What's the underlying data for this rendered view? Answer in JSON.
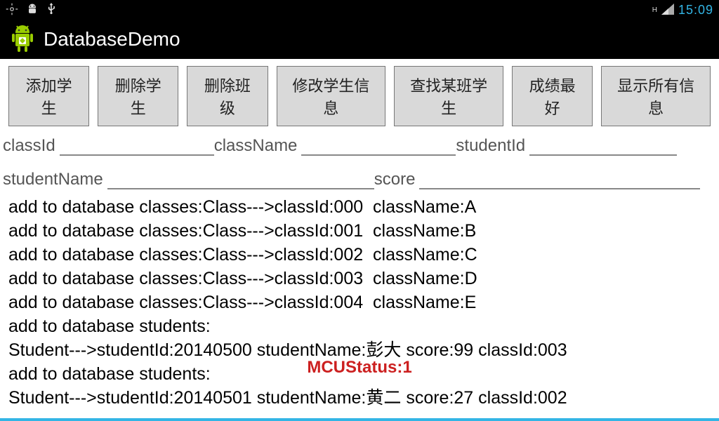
{
  "statusbar": {
    "clock": "15:09",
    "signal_badge": "H"
  },
  "app": {
    "title": "DatabaseDemo"
  },
  "buttons": [
    "添加学生",
    "删除学生",
    "删除班级",
    "修改学生信息",
    "查找某班学生",
    "成绩最好",
    "显示所有信息"
  ],
  "fields": {
    "row1": [
      {
        "label": "classId",
        "value": ""
      },
      {
        "label": "className",
        "value": ""
      },
      {
        "label": "studentId",
        "value": ""
      }
    ],
    "row2": [
      {
        "label": "studentName",
        "value": ""
      },
      {
        "label": "score",
        "value": ""
      }
    ]
  },
  "output_lines": [
    "add to database classes:Class--->classId:000  className:A",
    "add to database classes:Class--->classId:001  className:B",
    "add to database classes:Class--->classId:002  className:C",
    "add to database classes:Class--->classId:003  className:D",
    "add to database classes:Class--->classId:004  className:E",
    "add to database students:",
    "Student--->studentId:20140500 studentName:彭大 score:99 classId:003",
    "add to database students:",
    "Student--->studentId:20140501 studentName:黄二 score:27 classId:002"
  ],
  "overlay": "MCUStatus:1"
}
